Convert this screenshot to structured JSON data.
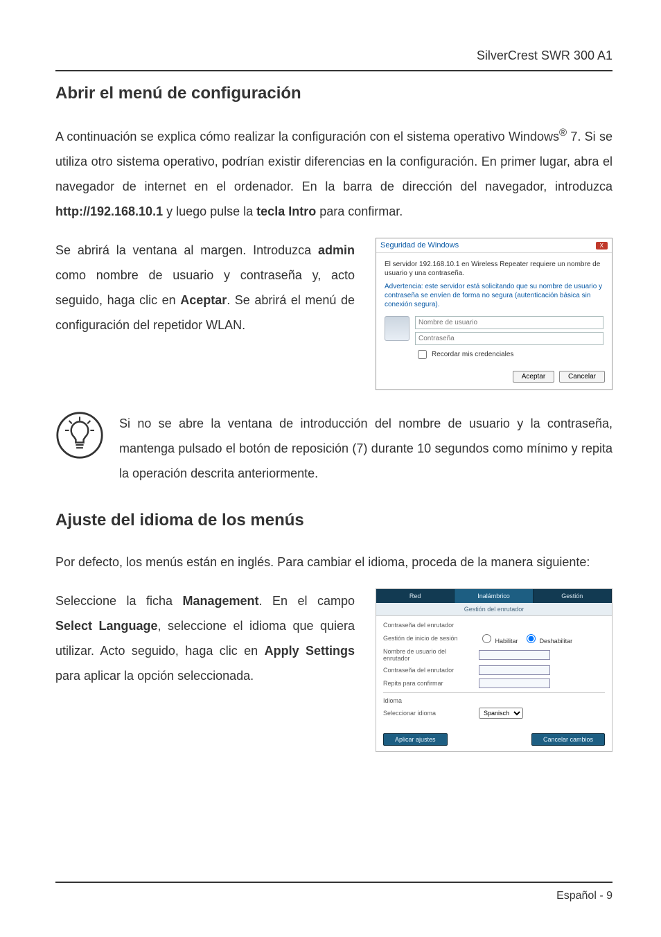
{
  "header": {
    "brand": "SilverCrest SWR 300 A1"
  },
  "section1": {
    "title": "Abrir el menú de configuración",
    "para1_a": "A continuación se explica cómo realizar la configuración con el sistema operativo Windows",
    "para1_b": " 7. Si se utiliza otro sistema operativo, podrían existir diferencias en la configuración. En primer lugar, abra el navegador de internet en el ordenador. En la barra de dirección del navegador, introduzca ",
    "url": "http://192.168.10.1",
    "para1_c": " y luego pulse la ",
    "intro_key": "tecla Intro",
    "para1_d": " para confirmar.",
    "para2_a": "Se abrirá la ventana al margen. Introduzca ",
    "admin": "admin",
    "para2_b": " como nombre de usuario y contraseña y, acto seguido, haga clic en ",
    "aceptar": "Aceptar",
    "para2_c": ". Se abrirá el menú de configuración del repetidor WLAN.",
    "tip": "Si no se abre la ventana de introducción del nombre de usuario y la contraseña, mantenga pulsado el botón de reposición (7) durante 10 segundos como mínimo y repita la operación descrita anteriormente."
  },
  "dialog": {
    "title": "Seguridad de Windows",
    "msg": "El servidor 192.168.10.1 en Wireless Repeater requiere un nombre de usuario y una contraseña.",
    "warn": "Advertencia: este servidor está solicitando que su nombre de usuario y contraseña se envíen de forma no segura (autenticación básica sin conexión segura).",
    "user_ph": "Nombre de usuario",
    "pass_ph": "Contraseña",
    "remember": "Recordar mis credenciales",
    "ok": "Aceptar",
    "cancel": "Cancelar"
  },
  "section2": {
    "title": "Ajuste del idioma de los menús",
    "para1": "Por defecto, los menús están en inglés. Para cambiar el idioma, proceda de la manera siguiente:",
    "para2_a": "Seleccione la ficha ",
    "management": "Management",
    "para2_b": ". En el campo ",
    "select_lang": "Select Language",
    "para2_c": ", seleccione el idioma que quiera utilizar. Acto seguido, haga clic en ",
    "apply": "Apply Settings",
    "para2_d": " para aplicar la opción seleccionada."
  },
  "router": {
    "tab1": "Red",
    "tab2": "Inalámbrico",
    "tab3": "Gestión",
    "subhead": "Gestión del enrutador",
    "row1": "Contraseña del enrutador",
    "row2": "Gestión de inicio de sesión",
    "row2_opt1": "Habilitar",
    "row2_opt2": "Deshabilitar",
    "row3": "Nombre de usuario del enrutador",
    "row4": "Contraseña del enrutador",
    "row5": "Repita para confirmar",
    "row_lang_head": "Idioma",
    "row_lang": "Seleccionar idioma",
    "lang_val": "Spanisch",
    "btn_apply": "Aplicar ajustes",
    "btn_cancel": "Cancelar cambios"
  },
  "footer": {
    "text": "Español  - 9"
  }
}
